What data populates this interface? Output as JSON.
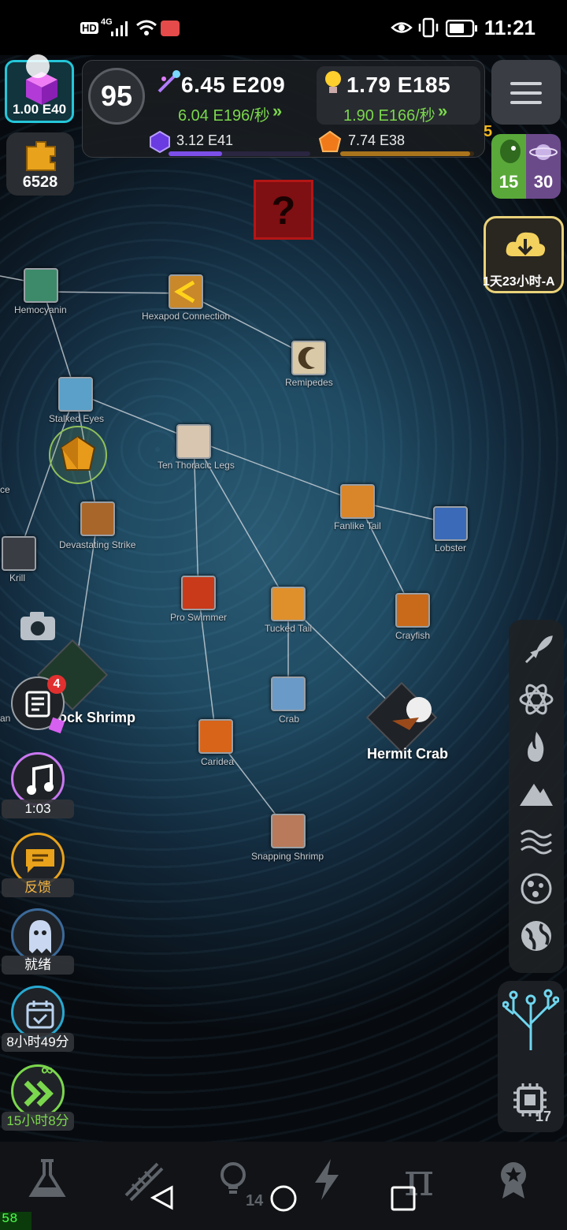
{
  "status_bar": {
    "hd": "HD",
    "network": "4G",
    "time": "11:21"
  },
  "header": {
    "level": "95",
    "cube_value": "1.00 E40",
    "puzzle_value": "6528",
    "dna": {
      "main": "6.45 E209",
      "rate": "6.04 E196/秒"
    },
    "idea": {
      "main": "1.79 E185",
      "rate": "1.90 E166/秒"
    },
    "gem": {
      "value": "3.12 E41",
      "progress": 0.38
    },
    "orb": {
      "value": "7.74 E38",
      "progress": 0.97
    }
  },
  "right_top": {
    "badge": "5",
    "left_count": "15",
    "right_count": "30",
    "cloud_timer": "1天23小时-A"
  },
  "tree": {
    "nodes": {
      "hemocyanin": "Hemocyanin",
      "hexapod": "Hexapod Connection",
      "remipedes": "Remipedes",
      "stalked_eyes": "Stalked Eyes",
      "ten_legs": "Ten Thoracic Legs",
      "fanlike_tail": "Fanlike Tail",
      "lobster": "Lobster",
      "devastating": "Devastating Strike",
      "krill": "Krill",
      "pro_swimmer": "Pro Swimmer",
      "tucked_tail": "Tucked Tail",
      "crayfish": "Crayfish",
      "crab": "Crab",
      "caridea": "Caridea",
      "snapping": "Snapping Shrimp",
      "left_edge_ce": "ce",
      "left_edge_an": "an"
    },
    "big_nodes": {
      "mantis": "ock Shrimp",
      "hermit": "Hermit Crab"
    }
  },
  "left_column": {
    "news_badge": "4",
    "music_time": "1:03",
    "feedback": "反馈",
    "ghost_status": "就绪",
    "calendar_timer": "8小时49分",
    "boost_timer": "15小时8分"
  },
  "right_column": {
    "icons": [
      "rocket-icon",
      "atom-icon",
      "fire-icon",
      "mountain-icon",
      "waves-icon",
      "cells-icon",
      "globe-icon"
    ],
    "chip_count": "17"
  },
  "bottom_nav": {
    "idea_count": "14"
  },
  "fps": "58"
}
